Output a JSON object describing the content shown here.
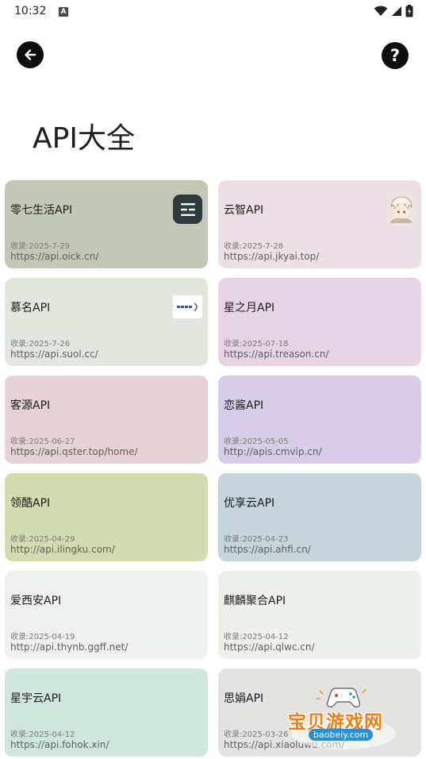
{
  "status_bar": {
    "time": "10:32",
    "a_icon": "A"
  },
  "header": {
    "back_icon": "arrow-left-icon",
    "help_icon": "question-icon",
    "help_glyph": "?"
  },
  "page": {
    "title": "API大全"
  },
  "cards": [
    {
      "name": "零七生活API",
      "date": "收录:2025-7-29",
      "url": "https://api.oick.cn/",
      "bg": "#c3c7b7",
      "icon": "menu-icon"
    },
    {
      "name": "云智API",
      "date": "收录:2025-7-28",
      "url": "https://api.jkyai.top/",
      "bg": "#eddfe6",
      "icon": "anime-avatar-icon"
    },
    {
      "name": "慕名API",
      "date": "收录:2025-7-26",
      "url": "https://api.suol.cc/",
      "bg": "#e1e7de",
      "icon": "site-logo-icon"
    },
    {
      "name": "星之月API",
      "date": "收录:2025-07-18",
      "url": "https://api.treason.cn/",
      "bg": "#e6d4e4",
      "icon": ""
    },
    {
      "name": "客源API",
      "date": "收录:2025-06-27",
      "url": "https://api.qster.top/home/",
      "bg": "#e6d1d4",
      "icon": ""
    },
    {
      "name": "恋酱API",
      "date": "收录:2025-05-05",
      "url": "http://apis.cmvip.cn/",
      "bg": "#d8cde8",
      "icon": ""
    },
    {
      "name": "领酷API",
      "date": "收录:2025-04-29",
      "url": "http://api.ilingku.com/",
      "bg": "#d3dcb1",
      "icon": ""
    },
    {
      "name": "优享云API",
      "date": "收录:2025-04-23",
      "url": "https://api.ahfi.cn/",
      "bg": "#c5d5da",
      "icon": ""
    },
    {
      "name": "爱西安API",
      "date": "收录:2025-04-19",
      "url": "http://api.thynb.ggff.net/",
      "bg": "#eef1ef",
      "icon": ""
    },
    {
      "name": "麒麟聚合API",
      "date": "收录:2025-04-12",
      "url": "https://api.qlwc.cn/",
      "bg": "#eef0ec",
      "icon": ""
    },
    {
      "name": "星宇云API",
      "date": "收录:2025-04-12",
      "url": "https://api.fohok.xin/",
      "bg": "#cfe6dc",
      "icon": ""
    },
    {
      "name": "思娟API",
      "date": "收录:2025-03-26",
      "url": "https://api.xiaoluwu.com/",
      "bg": "#e3e3e1",
      "icon": ""
    }
  ],
  "watermark": {
    "text": "宝贝游戏网",
    "domain": "baobeiy.com"
  }
}
